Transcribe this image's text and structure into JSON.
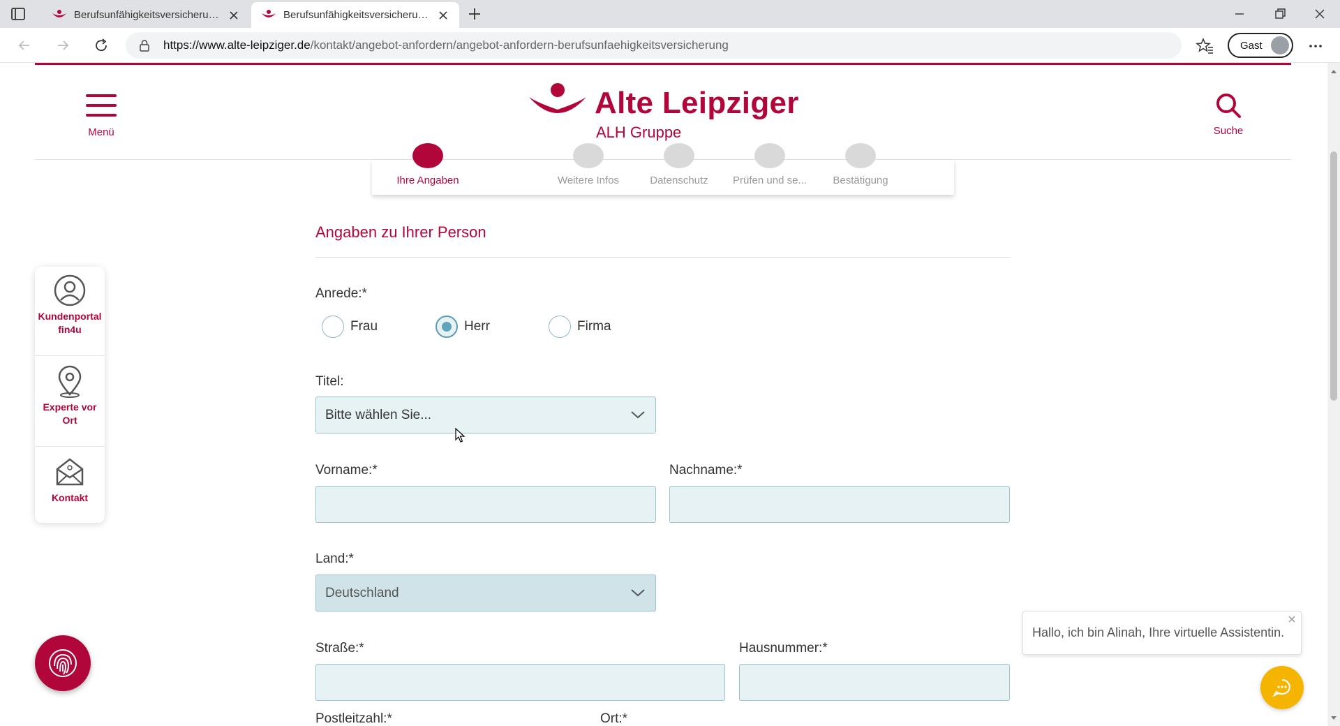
{
  "browser": {
    "tabs": [
      {
        "title": "Berufsunfähigkeitsversicherung | ",
        "active": false
      },
      {
        "title": "Berufsunfähigkeitsversicherung | ",
        "active": true
      }
    ],
    "url_domain": "https://www.alte-leipziger.de",
    "url_path": "/kontakt/angebot-anfordern/angebot-anfordern-berufsunfaehigkeitsversicherung",
    "profile_label": "Gast"
  },
  "header": {
    "menu_label": "Menü",
    "logo_text": "Alte Leipziger",
    "logo_sub": "ALH Gruppe",
    "search_label": "Suche",
    "brand_color": "#b0063a"
  },
  "stepper": {
    "steps": [
      {
        "label": "Ihre Angaben",
        "state": "current"
      },
      {
        "label": "Weitere Infos",
        "state": "pending"
      },
      {
        "label": "Datenschutz",
        "state": "pending"
      },
      {
        "label": "Prüfen und se...",
        "state": "pending"
      },
      {
        "label": "Bestätigung",
        "state": "pending"
      }
    ]
  },
  "form": {
    "section_title": "Angaben zu Ihrer Person",
    "anrede_label": "Anrede:*",
    "anrede_options": [
      "Frau",
      "Herr",
      "Firma"
    ],
    "anrede_selected": "Herr",
    "titel_label": "Titel:",
    "titel_value": "Bitte wählen Sie...",
    "vorname_label": "Vorname:*",
    "vorname_value": "",
    "nachname_label": "Nachname:*",
    "nachname_value": "",
    "land_label": "Land:*",
    "land_value": "Deutschland",
    "strasse_label": "Straße:*",
    "strasse_value": "",
    "hausnummer_label": "Hausnummer:*",
    "hausnummer_value": "",
    "plz_label": "Postleitzahl:*",
    "ort_label": "Ort:*"
  },
  "sidebar": {
    "items": [
      {
        "label": "Kundenportal fin4u",
        "icon": "user-circle-icon"
      },
      {
        "label": "Experte vor Ort",
        "icon": "location-pin-icon"
      },
      {
        "label": "Kontakt",
        "icon": "envelope-icon"
      }
    ]
  },
  "chat": {
    "message": "Hallo, ich bin Alinah, Ihre virtuelle Assistentin.",
    "accent": "#f5b400"
  }
}
